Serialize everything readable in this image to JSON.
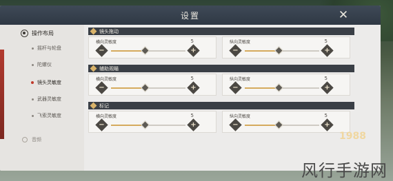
{
  "window": {
    "title": "设置"
  },
  "sidebar": {
    "header": {
      "label": "操作布局",
      "icon": "crosshair-icon"
    },
    "items": [
      {
        "label": "摇杆与轮盘",
        "active": false
      },
      {
        "label": "陀螺仪",
        "active": false
      },
      {
        "label": "镜头灵敏度",
        "active": true
      },
      {
        "label": "武器灵敏度",
        "active": false
      },
      {
        "label": "飞索灵敏度",
        "active": false
      }
    ],
    "footer": {
      "label": "音频"
    }
  },
  "sections": [
    {
      "title": "镜头拖动",
      "panels": [
        {
          "label": "横向灵敏度",
          "value": "5",
          "fraction": 0.45
        },
        {
          "label": "纵向灵敏度",
          "value": "5",
          "fraction": 0.45
        }
      ]
    },
    {
      "title": "辅助观瞄",
      "panels": [
        {
          "label": "横向灵敏度",
          "value": "5",
          "fraction": 0.45
        },
        {
          "label": "纵向灵敏度",
          "value": "5",
          "fraction": 0.45
        }
      ]
    },
    {
      "title": "标记",
      "panels": [
        {
          "label": "横向灵敏度",
          "value": "5",
          "fraction": 0.45
        },
        {
          "label": "纵向灵敏度",
          "value": "5",
          "fraction": 0.45
        }
      ]
    }
  ],
  "buttons": {
    "minus": "−",
    "plus": "+",
    "close": "✕"
  },
  "watermark": {
    "text": "风行手游网",
    "badge": "1988"
  },
  "colors": {
    "accent": "#c0392b",
    "slider_fill": "#d5aa5c",
    "header_bar": "#3a3f46"
  }
}
